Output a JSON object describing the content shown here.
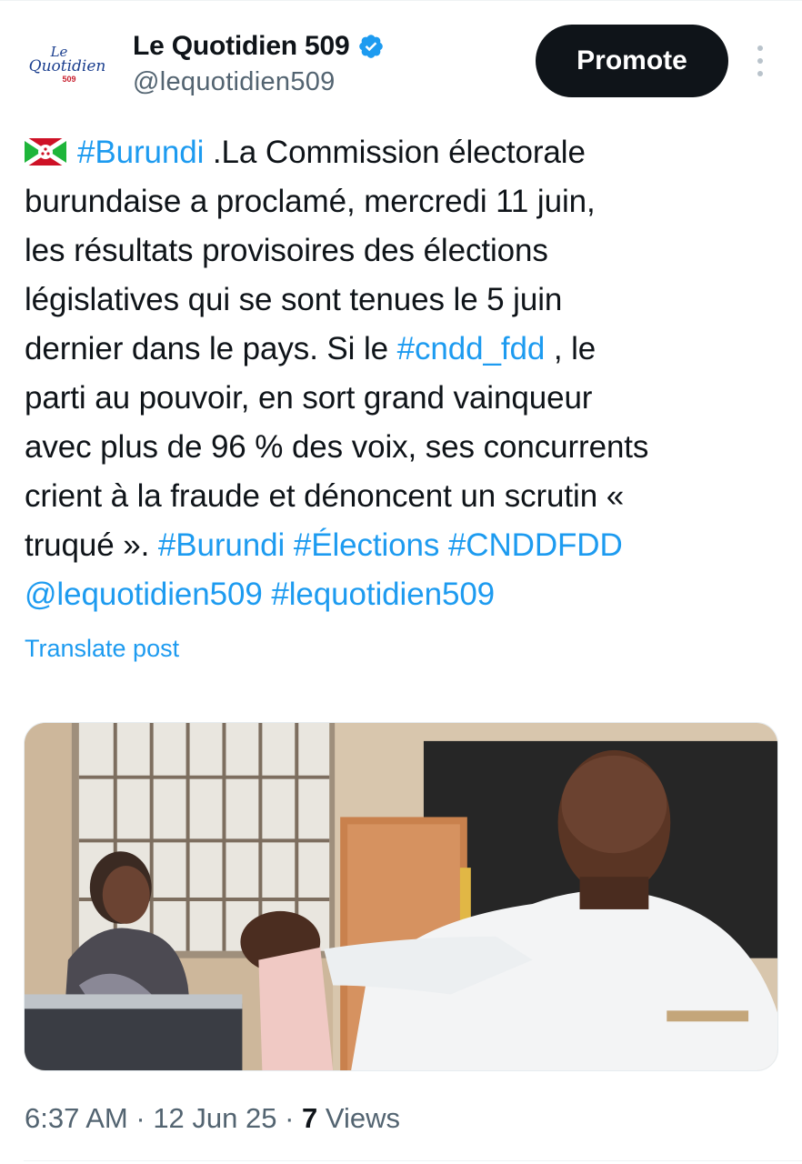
{
  "account": {
    "name": "Le Quotidien 509",
    "handle": "@lequotidien509",
    "logo": {
      "line1": "Le",
      "line2": "Quotidien",
      "line3": "509"
    },
    "verified_color": "#1d9bf0"
  },
  "actions": {
    "promote_label": "Promote",
    "more_icon": "more-vertical-icon"
  },
  "post": {
    "flag_icon": "burundi-flag-icon",
    "lines": [
      [
        {
          "t": "#Burundi",
          "link": true
        },
        {
          "t": " .La Commission électorale"
        }
      ],
      [
        {
          "t": "burundaise a proclamé, mercredi 11 juin,"
        }
      ],
      [
        {
          "t": "les résultats provisoires des élections"
        }
      ],
      [
        {
          "t": "législatives qui se sont tenues le 5 juin"
        }
      ],
      [
        {
          "t": "dernier dans le pays. Si le "
        },
        {
          "t": "#cndd_fdd",
          "link": true
        },
        {
          "t": " , le"
        }
      ],
      [
        {
          "t": "parti au pouvoir, en sort grand vainqueur"
        }
      ],
      [
        {
          "t": "avec plus de 96 % des voix, ses concurrents"
        }
      ],
      [
        {
          "t": "crient à la fraude et dénoncent un scrutin «"
        }
      ],
      [
        {
          "t": "truqué ». "
        },
        {
          "t": "#Burundi",
          "link": true
        },
        {
          "t": " "
        },
        {
          "t": "#Élections",
          "link": true
        },
        {
          "t": " "
        },
        {
          "t": "#CNDDFDD",
          "link": true
        }
      ],
      [
        {
          "t": "@lequotidien509",
          "link": true
        },
        {
          "t": " "
        },
        {
          "t": "#lequotidien509",
          "link": true
        }
      ]
    ],
    "translate_label": "Translate post"
  },
  "meta": {
    "time": "6:37 AM",
    "separator": " · ",
    "date": "12 Jun 25",
    "views_count": "7",
    "views_label": " Views"
  },
  "colors": {
    "link": "#1d9bf0",
    "text": "#0f1419",
    "muted": "#536471",
    "button_bg": "#0f1419"
  }
}
